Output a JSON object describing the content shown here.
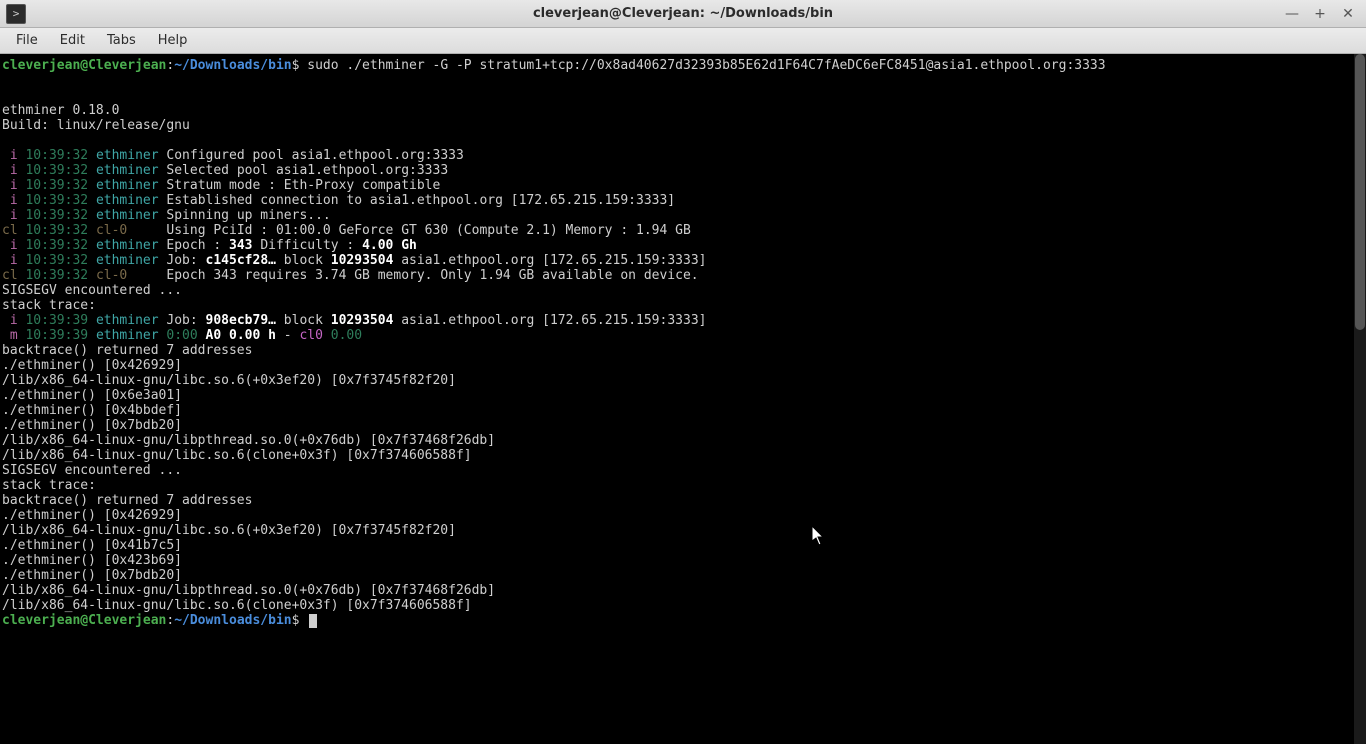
{
  "titlebar": {
    "title": "cleverjean@Cleverjean: ~/Downloads/bin"
  },
  "menubar": {
    "file": "File",
    "edit": "Edit",
    "tabs": "Tabs",
    "help": "Help"
  },
  "prompt": {
    "userhost": "cleverjean@Cleverjean",
    "colon": ":",
    "path": "~/Downloads/bin",
    "sigil": "$",
    "cmd": " sudo ./ethminer -G -P stratum1+tcp://0x8ad40627d32393b85E62d1F64C7fAeDC6eFC8451@asia1.ethpool.org:3333"
  },
  "header": {
    "blank": "",
    "version": "ethminer 0.18.0",
    "build": "Build: linux/release/gnu"
  },
  "log": [
    {
      "tag": " i",
      "tagc": "pk",
      "ts": "10:39:32",
      "src": "ethminer",
      "srcc": "cy",
      "msg": " Configured pool asia1.ethpool.org:3333"
    },
    {
      "tag": " i",
      "tagc": "pk",
      "ts": "10:39:32",
      "src": "ethminer",
      "srcc": "cy",
      "msg": " Selected pool asia1.ethpool.org:3333"
    },
    {
      "tag": " i",
      "tagc": "pk",
      "ts": "10:39:32",
      "src": "ethminer",
      "srcc": "cy",
      "msg": " Stratum mode : Eth-Proxy compatible"
    },
    {
      "tag": " i",
      "tagc": "pk",
      "ts": "10:39:32",
      "src": "ethminer",
      "srcc": "cy",
      "msg": " Established connection to asia1.ethpool.org [172.65.215.159:3333]"
    },
    {
      "tag": " i",
      "tagc": "pk",
      "ts": "10:39:32",
      "src": "ethminer",
      "srcc": "cy",
      "msg": " Spinning up miners..."
    },
    {
      "tag": "cl",
      "tagc": "br",
      "ts": "10:39:32",
      "src": "cl-0    ",
      "srcc": "br",
      "msg": " Using PciId : 01:00.0 GeForce GT 630 (Compute 2.1) Memory : 1.94 GB"
    },
    {
      "tag": " i",
      "tagc": "pk",
      "ts": "10:39:32",
      "src": "ethminer",
      "srcc": "cy",
      "msg_pre": " Epoch : ",
      "msg_b": "343",
      "msg_mid": " Difficulty : ",
      "msg_b2": "4.00 Gh"
    },
    {
      "tag": " i",
      "tagc": "pk",
      "ts": "10:39:32",
      "src": "ethminer",
      "srcc": "cy",
      "msg_pre": " Job: ",
      "msg_b": "c145cf28…",
      "msg_mid": " block ",
      "msg_b2": "10293504",
      "msg_post": " asia1.ethpool.org [172.65.215.159:3333]"
    },
    {
      "tag": "cl",
      "tagc": "br",
      "ts": "10:39:32",
      "src": "cl-0    ",
      "srcc": "br",
      "msg": " Epoch 343 requires 3.74 GB memory. Only 1.94 GB available on device."
    }
  ],
  "post1": {
    "sigsegv": "SIGSEGV encountered ...",
    "stack": "stack trace:"
  },
  "log2": [
    {
      "tag": " i",
      "tagc": "pk",
      "ts": "10:39:39",
      "src": "ethminer",
      "srcc": "cy",
      "msg_pre": " Job: ",
      "msg_b": "908ecb79…",
      "msg_mid": " block ",
      "msg_b2": "10293504",
      "msg_post": " asia1.ethpool.org [172.65.215.159:3333]"
    }
  ],
  "metrics": {
    "tag": " m",
    "ts": "10:39:39",
    "src": "ethminer",
    "t0": " 0:00",
    "a0": " A0",
    "rate": " 0.00 h",
    "dash": " - ",
    "cl": "cl0",
    "cl_v": " 0.00"
  },
  "trace1": {
    "l0": "backtrace() returned 7 addresses",
    "l1": "./ethminer() [0x426929]",
    "l2": "/lib/x86_64-linux-gnu/libc.so.6(+0x3ef20) [0x7f3745f82f20]",
    "l3": "./ethminer() [0x6e3a01]",
    "l4": "./ethminer() [0x4bbdef]",
    "l5": "./ethminer() [0x7bdb20]",
    "l6": "/lib/x86_64-linux-gnu/libpthread.so.0(+0x76db) [0x7f37468f26db]",
    "l7": "/lib/x86_64-linux-gnu/libc.so.6(clone+0x3f) [0x7f374606588f]"
  },
  "post2": {
    "sigsegv": "SIGSEGV encountered ...",
    "stack": "stack trace:"
  },
  "trace2": {
    "l0": "backtrace() returned 7 addresses",
    "l1": "./ethminer() [0x426929]",
    "l2": "/lib/x86_64-linux-gnu/libc.so.6(+0x3ef20) [0x7f3745f82f20]",
    "l3": "./ethminer() [0x41b7c5]",
    "l4": "./ethminer() [0x423b69]",
    "l5": "./ethminer() [0x7bdb20]",
    "l6": "/lib/x86_64-linux-gnu/libpthread.so.0(+0x76db) [0x7f37468f26db]",
    "l7": "/lib/x86_64-linux-gnu/libc.so.6(clone+0x3f) [0x7f374606588f]"
  }
}
